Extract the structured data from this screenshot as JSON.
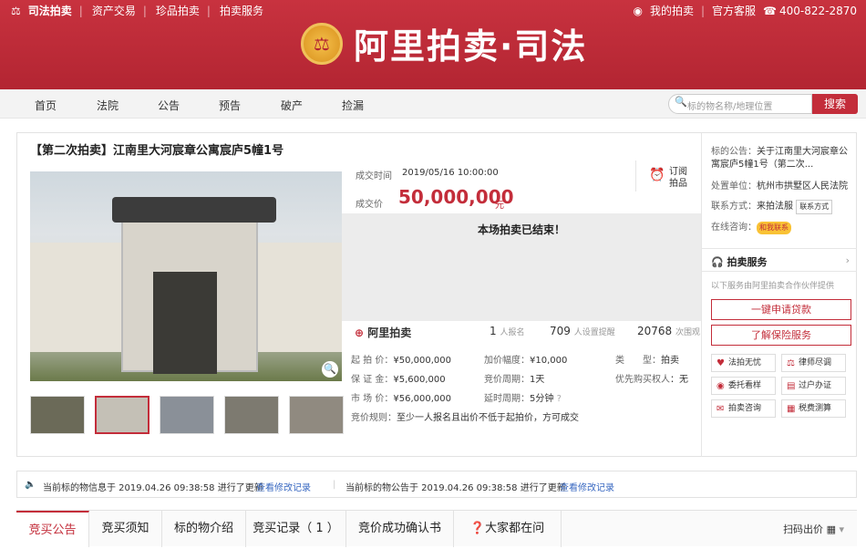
{
  "topbar": {
    "links": [
      "司法拍卖",
      "资产交易",
      "珍品拍卖",
      "拍卖服务"
    ],
    "my_auction": "我的拍卖",
    "service": "官方客服",
    "phone": "400-822-2870",
    "site_name": "阿里拍卖·司法"
  },
  "nav": {
    "items": [
      "首页",
      "法院",
      "公告",
      "预告",
      "破产",
      "捡漏"
    ],
    "search_placeholder": "标的物名称/地理位置",
    "search_button": "搜索"
  },
  "main": {
    "title": "【第二次拍卖】江南里大河宸章公寓宸庐5幢1号",
    "deal_time_label": "成交时间",
    "deal_time": "2019/05/16 10:00:00",
    "deal_price_label": "成交价",
    "deal_price": "50,000,000",
    "deal_unit": "元",
    "remind": "订阅拍品",
    "ended": "本场拍卖已结束！",
    "ali_logo": "阿里拍卖",
    "stats": [
      {
        "num": "1",
        "label": "人报名"
      },
      {
        "num": "709",
        "label": "人设置提醒"
      },
      {
        "num": "20768",
        "label": "次围观"
      }
    ],
    "params": [
      {
        "label": "起 拍 价：",
        "value": "¥50,000,000"
      },
      {
        "label": "加价幅度：",
        "value": "¥10,000"
      },
      {
        "label": "类　　型：",
        "value": "拍卖"
      },
      {
        "label": "保 证 金：",
        "value": "¥5,600,000"
      },
      {
        "label": "竞价周期：",
        "value": "1天"
      },
      {
        "label": "优先购买权人",
        "value": "：无"
      },
      {
        "label": "市 场 价：",
        "value": "¥56,000,000"
      },
      {
        "label": "延时周期：",
        "value": "5分钟"
      },
      {
        "label": "竞价规则：",
        "value": "至少一人报名且出价不低于起拍价，方可成交"
      }
    ]
  },
  "right": {
    "notice_label": "标的公告：",
    "notice_value": "关于江南里大河宸章公寓宸庐5幢1号（第二次...",
    "org_label": "处置单位：",
    "org_value": "杭州市拱墅区人民法院",
    "contact_label": "联系方式：",
    "contact_value": "来拍法服",
    "contact_btn": "联系方式",
    "ask_label": "在线咨询：",
    "ask_btn": "和我联系",
    "svc_title": "拍卖服务",
    "svc_note": "以下服务由阿里拍卖合作伙伴提供",
    "loan": "一键申请贷款",
    "insurance": "了解保险服务",
    "grid": [
      "法拍无忧",
      "律师尽调",
      "委托看样",
      "过户办证",
      "拍卖咨询",
      "税费测算"
    ]
  },
  "notice": {
    "left": "当前标的物信息于 2019.04.26 09:38:58 进行了更新",
    "left_link": "查看修改记录",
    "right": "当前标的物公告于 2019.04.26 09:38:58 进行了更新",
    "right_link": "查看修改记录"
  },
  "tabs": [
    "竞买公告",
    "竞买须知",
    "标的物介绍",
    "竞买记录（ 1 ）",
    "竞价成功确认书",
    "大家都在问"
  ],
  "qr": "扫码出价"
}
